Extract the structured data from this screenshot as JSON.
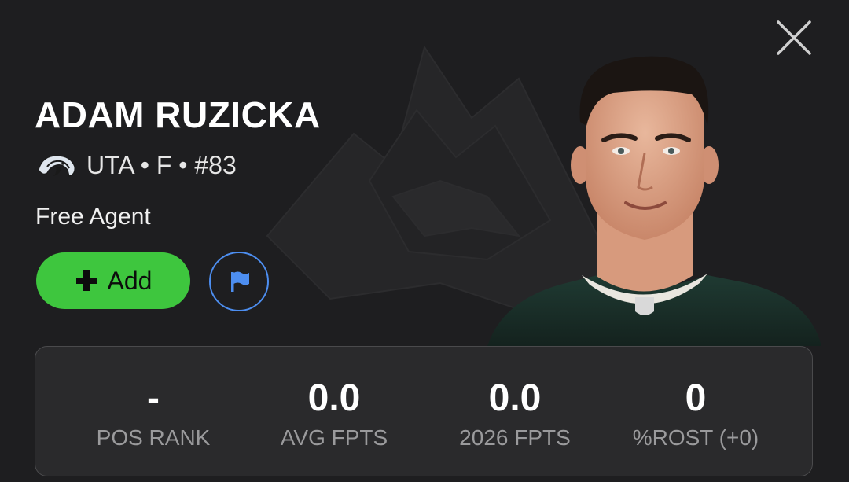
{
  "player": {
    "name": "ADAM RUZICKA",
    "team_info": "UTA • F • #83",
    "status": "Free Agent"
  },
  "actions": {
    "add_label": "Add"
  },
  "icons": {
    "close": "close-icon",
    "team_logo": "utah-mammoth-logo-icon",
    "plus": "plus-icon",
    "flag": "flag-icon"
  },
  "colors": {
    "add_button": "#3ec63e",
    "flag_accent": "#4d8ef0",
    "background": "#1e1e20",
    "panel": "#2a2a2c",
    "label": "#9a9a9c"
  },
  "stats": [
    {
      "value": "-",
      "label": "POS RANK"
    },
    {
      "value": "0.0",
      "label": "AVG FPTS"
    },
    {
      "value": "0.0",
      "label": "2026 FPTS"
    },
    {
      "value": "0",
      "label": "%ROST (+0)"
    }
  ]
}
